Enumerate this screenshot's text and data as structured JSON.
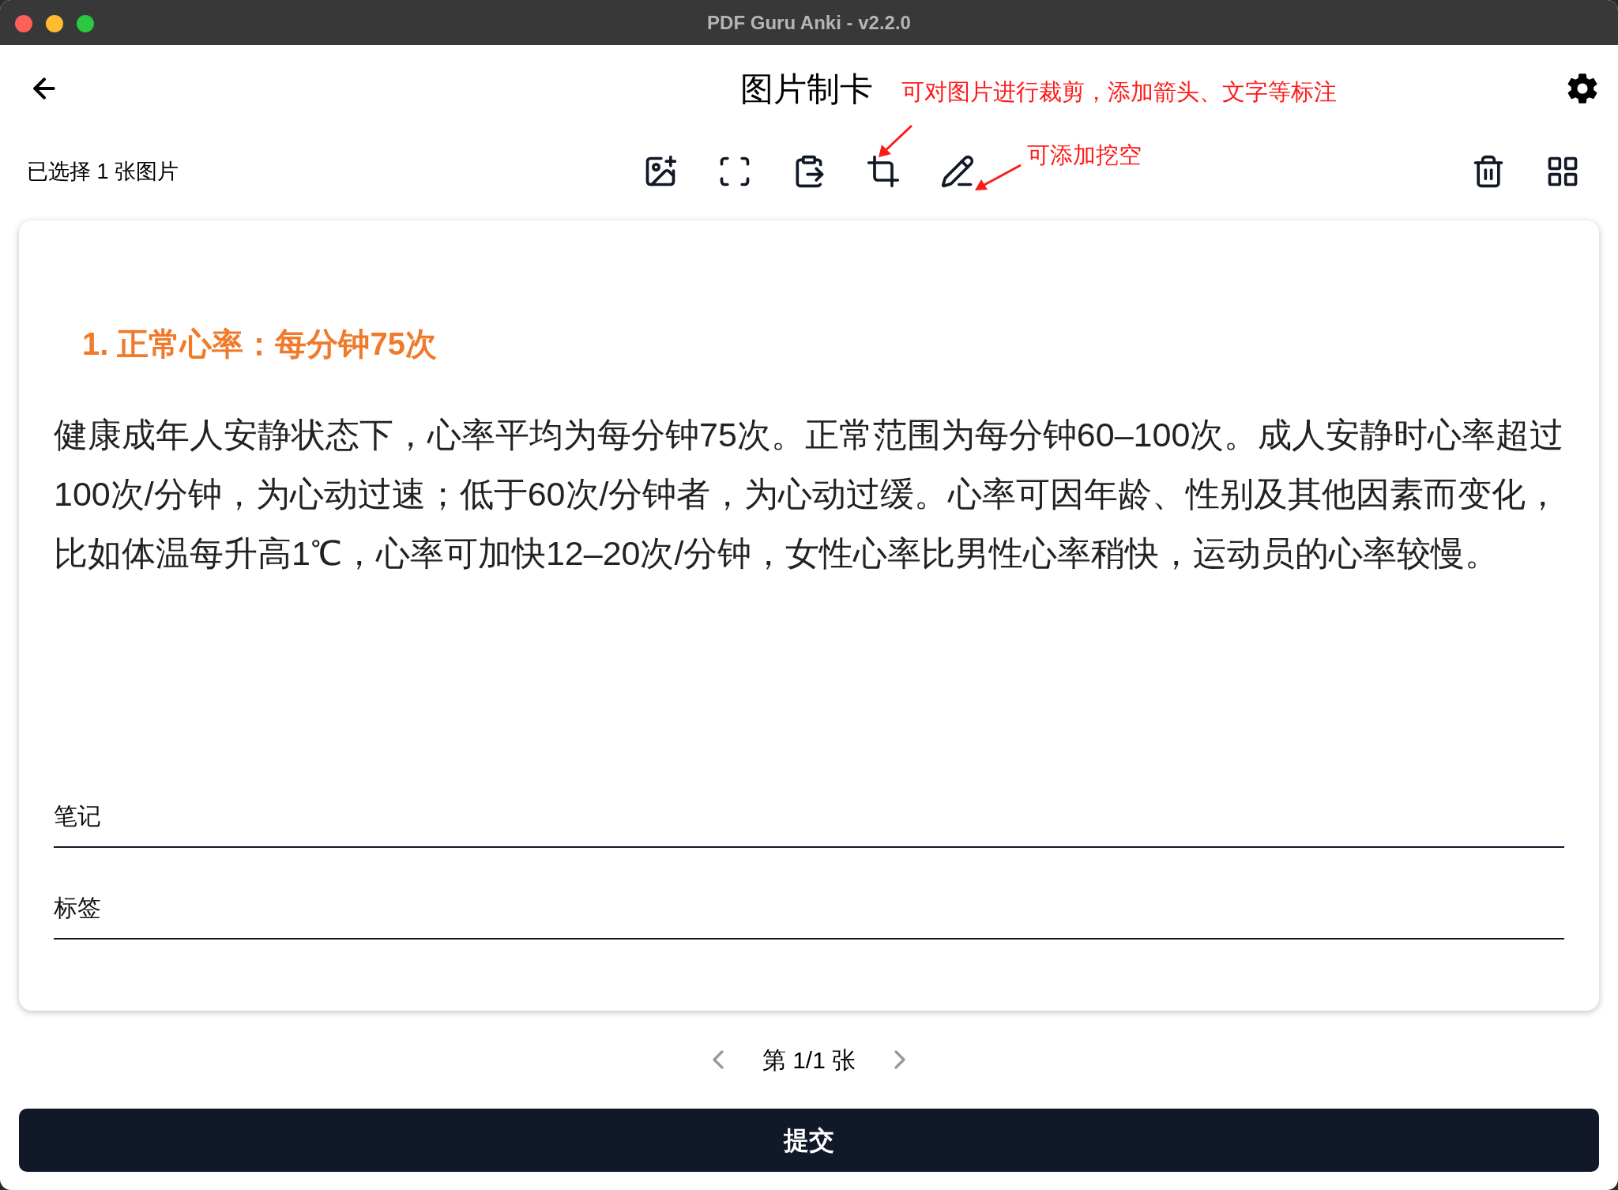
{
  "window": {
    "title": "PDF Guru Anki - v2.2.0"
  },
  "header": {
    "title": "图片制卡"
  },
  "toolbar": {
    "selection_count": "已选择 1 张图片"
  },
  "annotations": [
    {
      "text": "可对图片进行裁剪，添加箭头、文字等标注"
    },
    {
      "text": "可添加挖空"
    }
  ],
  "card": {
    "heading": "1. 正常心率：每分钟75次",
    "body": "健康成年人安静状态下，心率平均为每分钟75次。正常范围为每分钟60–100次。成人安静时心率超过100次/分钟，为心动过速；低于60次/分钟者，为心动过缓。心率可因年龄、性别及其他因素而变化，比如体温每升高1℃，心率可加快12–20次/分钟，女性心率比男性心率稍快，运动员的心率较慢。",
    "fields": [
      {
        "placeholder": "笔记"
      },
      {
        "placeholder": "标签"
      }
    ]
  },
  "pagination": {
    "label": "第 1/1 张",
    "prev_disabled": true,
    "next_disabled": true
  },
  "submit_button": "提交"
}
